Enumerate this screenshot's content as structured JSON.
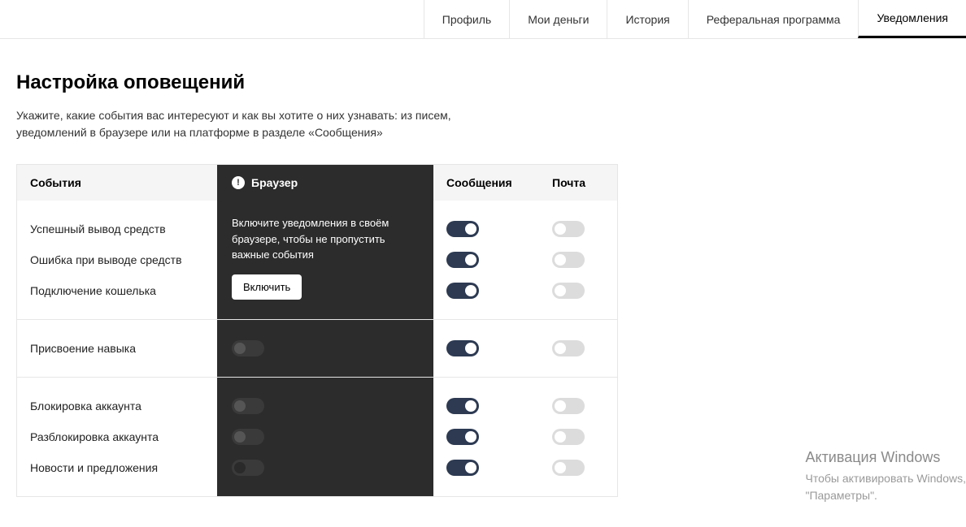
{
  "tabs": {
    "profile": "Профиль",
    "money": "Мои деньги",
    "history": "История",
    "referral": "Реферальная программа",
    "notif": "Уведомления"
  },
  "page": {
    "title": "Настройка оповещений",
    "desc": "Укажите, какие события вас интересуют и как вы хотите о них узнавать: из писем, уведомлений в браузере или на платформе в разделе «Сообщения»"
  },
  "columns": {
    "events": "События",
    "browser": "Браузер",
    "msg": "Сообщения",
    "mail": "Почта"
  },
  "browser_panel": {
    "hint": "Включите уведомления в своём браузере, чтобы не пропустить важные события",
    "button": "Включить"
  },
  "groups": [
    {
      "rows": [
        {
          "label": "Успешный вывод средств",
          "browser": null,
          "msg": true,
          "mail": false
        },
        {
          "label": "Ошибка при выводе средств",
          "browser": null,
          "msg": true,
          "mail": false
        },
        {
          "label": "Подключение кошелька",
          "browser": null,
          "msg": true,
          "mail": false
        }
      ]
    },
    {
      "rows": [
        {
          "label": "Присвоение навыка",
          "browser": "dark-off",
          "msg": true,
          "mail": false
        }
      ]
    },
    {
      "rows": [
        {
          "label": "Блокировка аккаунта",
          "browser": "dark-off",
          "msg": true,
          "mail": false
        },
        {
          "label": "Разблокировка аккаунта",
          "browser": "dark-off",
          "msg": true,
          "mail": false
        },
        {
          "label": "Новости и предложения",
          "browser": "dark-halfoff",
          "msg": true,
          "mail": false
        }
      ]
    }
  ],
  "watermark": {
    "title": "Активация Windows",
    "line1": "Чтобы активировать Windows,",
    "line2": "\"Параметры\"."
  }
}
